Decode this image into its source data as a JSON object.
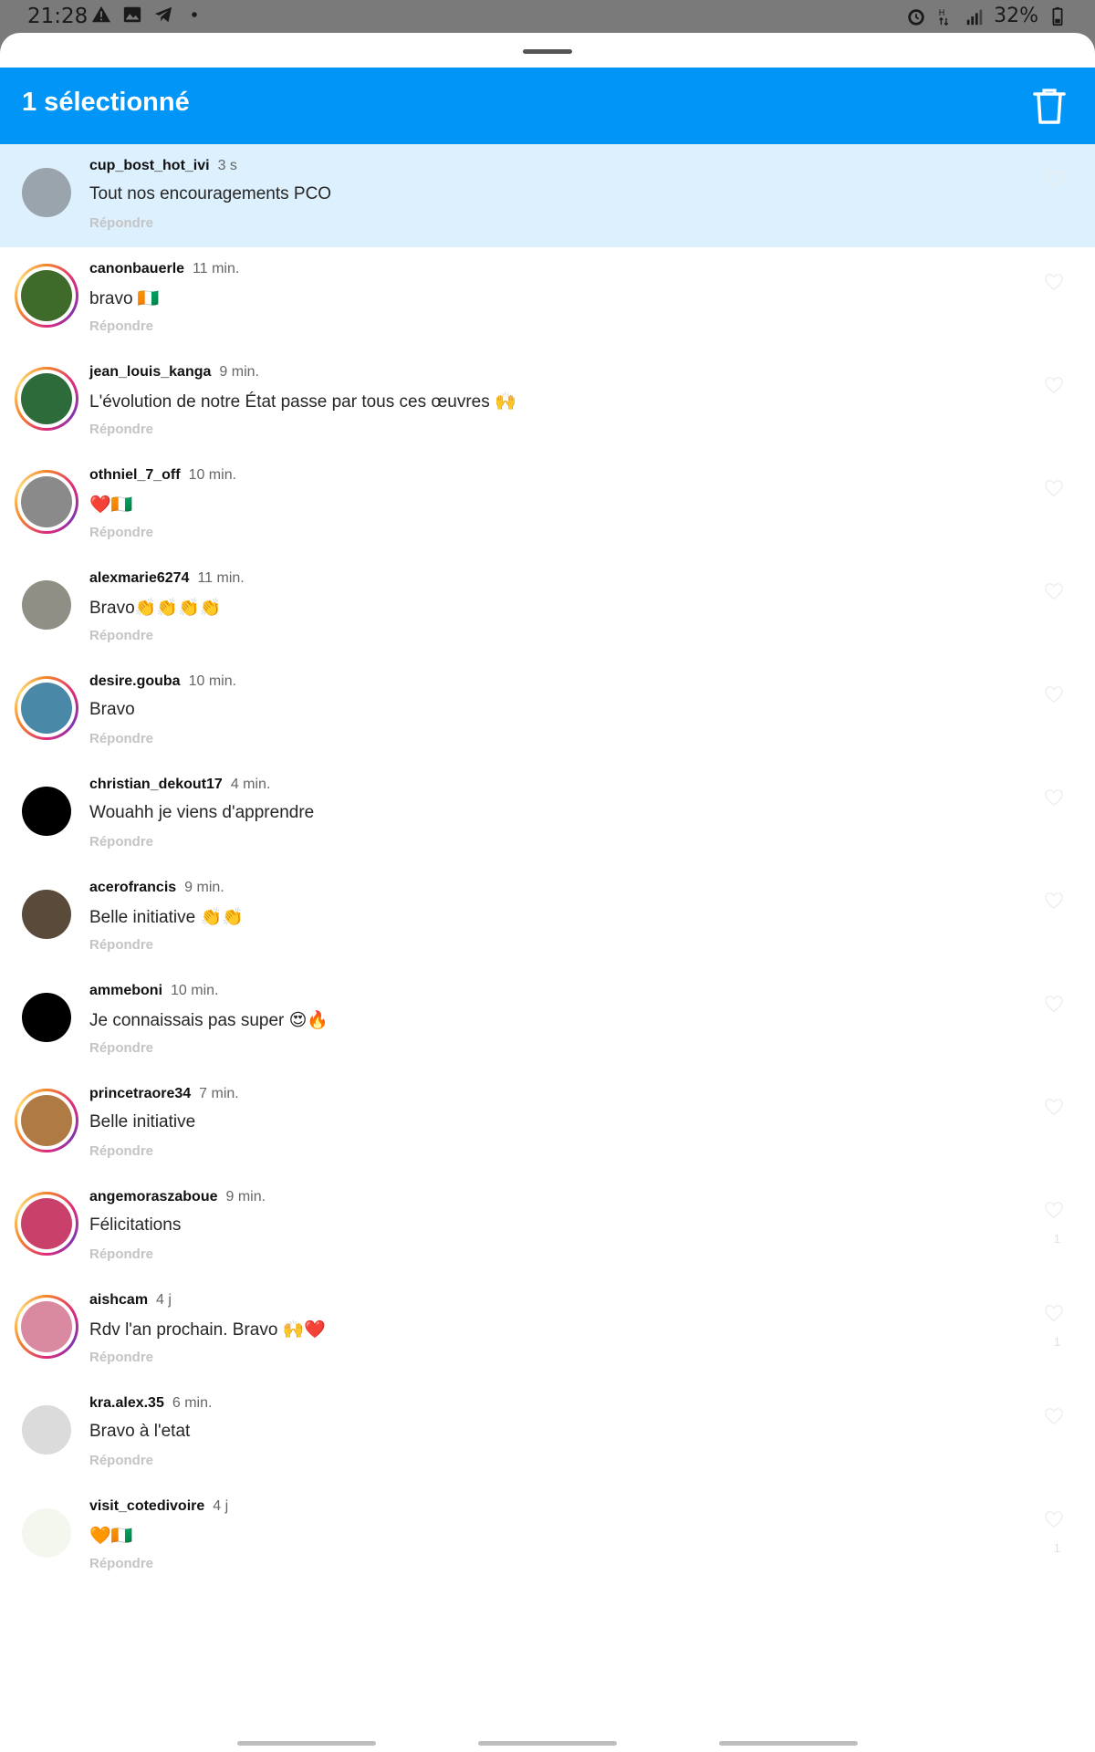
{
  "status_bar": {
    "time": "21:28",
    "battery": "32%",
    "left_icons": [
      "warning-icon",
      "image-icon",
      "telegram-icon",
      "dot-icon"
    ],
    "right_icons": [
      "alarm-icon",
      "network-h-icon",
      "signal-icon",
      "battery-icon"
    ]
  },
  "header": {
    "title": "1 sélectionné",
    "delete_icon": "trash-icon",
    "background": "#0095f6"
  },
  "reply_label": "Répondre",
  "comments": [
    {
      "username": "cup_bost_hot_ivi",
      "time": "3 s",
      "text": "Tout nos encouragements PCO",
      "selected": true,
      "story": false,
      "avatar_color": "#9aa4ad",
      "likes": ""
    },
    {
      "username": "canonbauerle",
      "time": "11 min.",
      "text": "bravo 🇨🇮",
      "selected": false,
      "story": true,
      "avatar_color": "#3f6b2a",
      "likes": ""
    },
    {
      "username": "jean_louis_kanga",
      "time": "9 min.",
      "text": "L'évolution de notre État passe par tous ces œuvres 🙌",
      "selected": false,
      "story": true,
      "avatar_color": "#2e6b3a",
      "likes": ""
    },
    {
      "username": "othniel_7_off",
      "time": "10 min.",
      "text": "❤️🇨🇮",
      "selected": false,
      "story": true,
      "avatar_color": "#8a8a8a",
      "likes": ""
    },
    {
      "username": "alexmarie6274",
      "time": "11 min.",
      "text": "Bravo👏👏👏👏",
      "selected": false,
      "story": false,
      "avatar_color": "#8f8f86",
      "likes": ""
    },
    {
      "username": "desire.gouba",
      "time": "10 min.",
      "text": "Bravo",
      "selected": false,
      "story": true,
      "avatar_color": "#4a88a8",
      "likes": ""
    },
    {
      "username": "christian_dekout17",
      "time": "4 min.",
      "text": "Wouahh je viens d'apprendre",
      "selected": false,
      "story": false,
      "avatar_color": "#000000",
      "likes": ""
    },
    {
      "username": "acerofrancis",
      "time": "9 min.",
      "text": "Belle initiative 👏👏",
      "selected": false,
      "story": false,
      "avatar_color": "#5a4a3a",
      "likes": ""
    },
    {
      "username": "ammeboni",
      "time": "10 min.",
      "text": "Je connaissais pas super 😍🔥",
      "selected": false,
      "story": false,
      "avatar_color": "#000000",
      "likes": ""
    },
    {
      "username": "princetraore34",
      "time": "7 min.",
      "text": "Belle initiative",
      "selected": false,
      "story": true,
      "avatar_color": "#b07a45",
      "likes": ""
    },
    {
      "username": "angemoraszaboue",
      "time": "9 min.",
      "text": "Félicitations",
      "selected": false,
      "story": true,
      "avatar_color": "#c9406a",
      "likes": "1"
    },
    {
      "username": "aishcam",
      "time": "4 j",
      "text": "Rdv l'an prochain. Bravo 🙌❤️",
      "selected": false,
      "story": true,
      "avatar_color": "#d98aa0",
      "likes": "1"
    },
    {
      "username": "kra.alex.35",
      "time": "6 min.",
      "text": "Bravo à l'etat",
      "selected": false,
      "story": false,
      "avatar_color": "#dbdbdb",
      "likes": ""
    },
    {
      "username": "visit_cotedivoire",
      "time": "4 j",
      "text": "🧡🇨🇮",
      "selected": false,
      "story": false,
      "avatar_color": "#f3f7ee",
      "likes": "1"
    }
  ]
}
